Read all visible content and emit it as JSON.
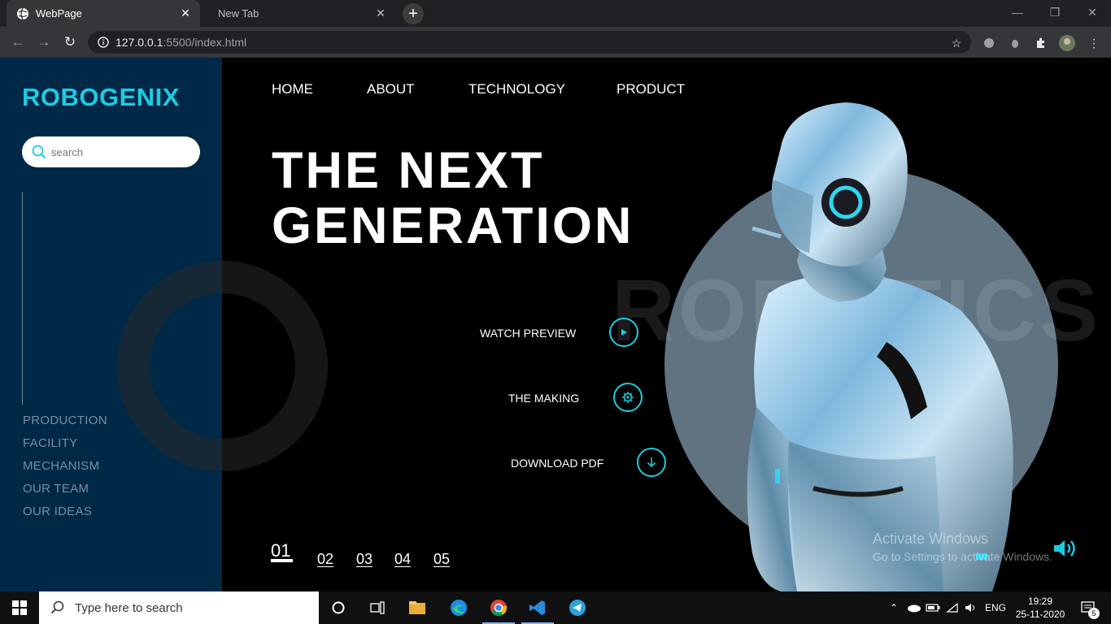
{
  "browser": {
    "tabs": [
      {
        "title": "WebPage",
        "active": true
      },
      {
        "title": "New Tab",
        "active": false
      }
    ],
    "url_host": "127.0.0.1",
    "url_path": ":5500/index.html"
  },
  "sidebar": {
    "logo": "ROBOGENIX",
    "search_placeholder": "search",
    "links": [
      "PRODUCTION",
      "FACILITY",
      "MECHANISM",
      "OUR TEAM",
      "OUR IDEAS"
    ]
  },
  "nav": [
    "HOME",
    "ABOUT",
    "TECHNOLOGY",
    "PRODUCT"
  ],
  "hero": {
    "line1": "THE NEXT",
    "line2": "GENERATION",
    "watermark": "ROBOTICS"
  },
  "actions": [
    {
      "label": "WATCH PREVIEW",
      "icon": "play-icon"
    },
    {
      "label": "THE MAKING",
      "icon": "gear-icon"
    },
    {
      "label": "DOWNLOAD PDF",
      "icon": "arrow-down-icon"
    }
  ],
  "pagination": [
    "01",
    "02",
    "03",
    "04",
    "05"
  ],
  "activation": {
    "title": "Activate Windows",
    "subtitle": "Go to Settings to activate Windows."
  },
  "taskbar": {
    "search_placeholder": "Type here to search",
    "language": "ENG",
    "time": "19:29",
    "date": "25-11-2020",
    "notification_count": "5"
  },
  "colors": {
    "accent": "#1ecbe1",
    "sidebar_bg": "#002847",
    "circle": "#5f7380"
  }
}
